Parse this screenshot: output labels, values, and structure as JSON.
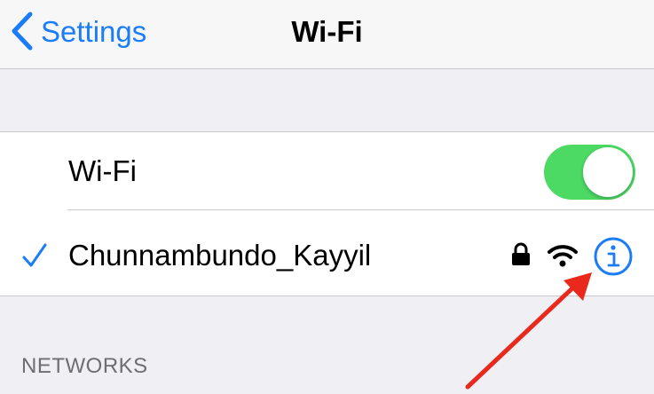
{
  "navbar": {
    "back_label": "Settings",
    "title": "Wi-Fi"
  },
  "wifi_toggle_row": {
    "label": "Wi-Fi",
    "enabled": true
  },
  "connected_network": {
    "name": "Chunnambundo_Kayyil",
    "secured": true
  },
  "networks_section": {
    "header": "NETWORKS"
  },
  "colors": {
    "accent": "#1b7cf7",
    "toggle_on": "#4cd964",
    "annotation_arrow": "#e8291c"
  },
  "icons": [
    "chevron-left-icon",
    "checkmark-icon",
    "lock-icon",
    "wifi-signal-icon",
    "info-icon",
    "arrow-annotation"
  ]
}
